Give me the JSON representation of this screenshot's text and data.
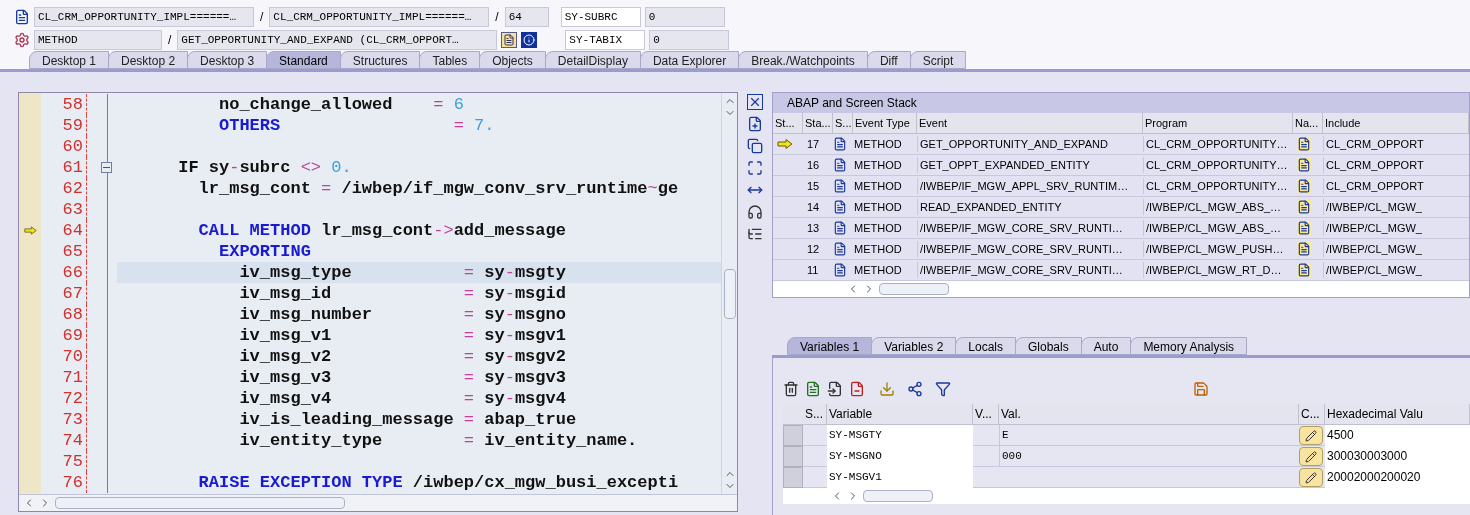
{
  "header": {
    "rows": [
      {
        "fields": [
          {
            "kind": "field",
            "text": "CL_CRM_OPPORTUNITY_IMPL======…"
          },
          {
            "kind": "sep",
            "text": "/"
          },
          {
            "kind": "field",
            "text": "CL_CRM_OPPORTUNITY_IMPL======…"
          },
          {
            "kind": "sep",
            "text": "/"
          },
          {
            "kind": "field",
            "text": "64"
          },
          {
            "kind": "sysname",
            "text": "SY-SUBRC"
          },
          {
            "kind": "field",
            "text": "0"
          }
        ]
      },
      {
        "fields": [
          {
            "kind": "field",
            "text": "METHOD"
          },
          {
            "kind": "sep",
            "text": "/"
          },
          {
            "kind": "field",
            "text": "GET_OPPORTUNITY_AND_EXPAND (CL_CRM_OPPORT…"
          },
          {
            "kind": "buttons"
          },
          {
            "kind": "sysname",
            "text": "SY-TABIX"
          },
          {
            "kind": "field",
            "text": "0"
          }
        ]
      }
    ]
  },
  "tabs": [
    {
      "label": "Desktop 1",
      "selected": false
    },
    {
      "label": "Desktop 2",
      "selected": false
    },
    {
      "label": "Desktop 3",
      "selected": false
    },
    {
      "label": "Standard",
      "selected": true
    },
    {
      "label": "Structures",
      "selected": false
    },
    {
      "label": "Tables",
      "selected": false
    },
    {
      "label": "Objects",
      "selected": false
    },
    {
      "label": "DetailDisplay",
      "selected": false
    },
    {
      "label": "Data Explorer",
      "selected": false
    },
    {
      "label": "Break./Watchpoints",
      "selected": false
    },
    {
      "label": "Diff",
      "selected": false
    },
    {
      "label": "Script",
      "selected": false
    }
  ],
  "editor": {
    "lines": [
      {
        "number": "58",
        "current": false,
        "cursor": false,
        "fold": false,
        "segments": [
          {
            "kind": "plain",
            "text": "          no_change_allowed    "
          },
          {
            "kind": "operator",
            "text": "="
          },
          {
            "kind": "number",
            "text": " 6"
          }
        ]
      },
      {
        "number": "59",
        "current": false,
        "cursor": false,
        "fold": false,
        "segments": [
          {
            "kind": "keyword",
            "text": "          OTHERS                 "
          },
          {
            "kind": "operator",
            "text": "="
          },
          {
            "kind": "number",
            "text": " 7."
          }
        ]
      },
      {
        "number": "60",
        "current": false,
        "cursor": false,
        "fold": false
      },
      {
        "number": "61",
        "current": false,
        "cursor": false,
        "fold": true,
        "segments": [
          {
            "kind": "plain",
            "text": "      IF sy"
          },
          {
            "kind": "operator",
            "text": "-"
          },
          {
            "kind": "plain",
            "text": "subrc "
          },
          {
            "kind": "operator",
            "text": "<>"
          },
          {
            "kind": "number",
            "text": " 0."
          }
        ]
      },
      {
        "number": "62",
        "current": false,
        "cursor": false,
        "fold": false,
        "segments": [
          {
            "kind": "plain",
            "text": "        lr_msg_cont "
          },
          {
            "kind": "operator",
            "text": "="
          },
          {
            "kind": "plain",
            "text": " /iwbep/if_mgw_conv_srv_runtime"
          },
          {
            "kind": "operator",
            "text": "~"
          },
          {
            "kind": "plain",
            "text": "ge"
          }
        ]
      },
      {
        "number": "63",
        "current": false,
        "cursor": false,
        "fold": false
      },
      {
        "number": "64",
        "current": true,
        "cursor": false,
        "fold": false,
        "segments": [
          {
            "kind": "keyword",
            "text": "        CALL METHOD"
          },
          {
            "kind": "plain",
            "text": " lr_msg_cont"
          },
          {
            "kind": "operator",
            "text": "->"
          },
          {
            "kind": "plain",
            "text": "add_message"
          }
        ]
      },
      {
        "number": "65",
        "current": false,
        "cursor": false,
        "fold": false,
        "segments": [
          {
            "kind": "keyword",
            "text": "          EXPORTING"
          }
        ]
      },
      {
        "number": "66",
        "current": false,
        "cursor": true,
        "fold": false,
        "segments": [
          {
            "kind": "plain",
            "text": "            iv_msg_type           "
          },
          {
            "kind": "operator",
            "text": "="
          },
          {
            "kind": "plain",
            "text": " sy"
          },
          {
            "kind": "operator",
            "text": "-"
          },
          {
            "kind": "plain",
            "text": "msgty"
          }
        ]
      },
      {
        "number": "67",
        "current": false,
        "cursor": false,
        "fold": false,
        "segments": [
          {
            "kind": "plain",
            "text": "            iv_msg_id             "
          },
          {
            "kind": "operator",
            "text": "="
          },
          {
            "kind": "plain",
            "text": " sy"
          },
          {
            "kind": "operator",
            "text": "-"
          },
          {
            "kind": "plain",
            "text": "msgid"
          }
        ]
      },
      {
        "number": "68",
        "current": false,
        "cursor": false,
        "fold": false,
        "segments": [
          {
            "kind": "plain",
            "text": "            iv_msg_number         "
          },
          {
            "kind": "operator",
            "text": "="
          },
          {
            "kind": "plain",
            "text": " sy"
          },
          {
            "kind": "operator",
            "text": "-"
          },
          {
            "kind": "plain",
            "text": "msgno"
          }
        ]
      },
      {
        "number": "69",
        "current": false,
        "cursor": false,
        "fold": false,
        "segments": [
          {
            "kind": "plain",
            "text": "            iv_msg_v1             "
          },
          {
            "kind": "operator",
            "text": "="
          },
          {
            "kind": "plain",
            "text": " sy"
          },
          {
            "kind": "operator",
            "text": "-"
          },
          {
            "kind": "plain",
            "text": "msgv1"
          }
        ]
      },
      {
        "number": "70",
        "current": false,
        "cursor": false,
        "fold": false,
        "segments": [
          {
            "kind": "plain",
            "text": "            iv_msg_v2             "
          },
          {
            "kind": "operator",
            "text": "="
          },
          {
            "kind": "plain",
            "text": " sy"
          },
          {
            "kind": "operator",
            "text": "-"
          },
          {
            "kind": "plain",
            "text": "msgv2"
          }
        ]
      },
      {
        "number": "71",
        "current": false,
        "cursor": false,
        "fold": false,
        "segments": [
          {
            "kind": "plain",
            "text": "            iv_msg_v3             "
          },
          {
            "kind": "operator",
            "text": "="
          },
          {
            "kind": "plain",
            "text": " sy"
          },
          {
            "kind": "operator",
            "text": "-"
          },
          {
            "kind": "plain",
            "text": "msgv3"
          }
        ]
      },
      {
        "number": "72",
        "current": false,
        "cursor": false,
        "fold": false,
        "segments": [
          {
            "kind": "plain",
            "text": "            iv_msg_v4             "
          },
          {
            "kind": "operator",
            "text": "="
          },
          {
            "kind": "plain",
            "text": " sy"
          },
          {
            "kind": "operator",
            "text": "-"
          },
          {
            "kind": "plain",
            "text": "msgv4"
          }
        ]
      },
      {
        "number": "73",
        "current": false,
        "cursor": false,
        "fold": false,
        "segments": [
          {
            "kind": "plain",
            "text": "            iv_is_leading_message "
          },
          {
            "kind": "operator",
            "text": "="
          },
          {
            "kind": "plain",
            "text": " abap_true"
          }
        ]
      },
      {
        "number": "74",
        "current": false,
        "cursor": false,
        "fold": false,
        "segments": [
          {
            "kind": "plain",
            "text": "            iv_entity_type        "
          },
          {
            "kind": "operator",
            "text": "="
          },
          {
            "kind": "plain",
            "text": " iv_entity_name."
          }
        ]
      },
      {
        "number": "75",
        "current": false,
        "cursor": false,
        "fold": false
      },
      {
        "number": "76",
        "current": false,
        "cursor": false,
        "fold": false,
        "segments": [
          {
            "kind": "keyword",
            "text": "        RAISE EXCEPTION TYPE"
          },
          {
            "kind": "plain",
            "text": " /iwbep/cx_mgw_busi_excepti"
          }
        ]
      }
    ]
  },
  "stack": {
    "title": "ABAP and Screen Stack",
    "columns": [
      "St...",
      "Sta...",
      "S...",
      "Event Type",
      "Event",
      "Program",
      "Na...",
      "Include"
    ],
    "rows": [
      {
        "current": true,
        "stack_no": "17",
        "event_type": "METHOD",
        "event": "GET_OPPORTUNITY_AND_EXPAND",
        "program": "CL_CRM_OPPORTUNITY…",
        "include": "CL_CRM_OPPORT"
      },
      {
        "current": false,
        "stack_no": "16",
        "event_type": "METHOD",
        "event": "GET_OPPT_EXPANDED_ENTITY",
        "program": "CL_CRM_OPPORTUNITY…",
        "include": "CL_CRM_OPPORT"
      },
      {
        "current": false,
        "stack_no": "15",
        "event_type": "METHOD",
        "event": "/IWBEP/IF_MGW_APPL_SRV_RUNTIM…",
        "program": "CL_CRM_OPPORTUNITY…",
        "include": "CL_CRM_OPPORT"
      },
      {
        "current": false,
        "stack_no": "14",
        "event_type": "METHOD",
        "event": "READ_EXPANDED_ENTITY",
        "program": "/IWBEP/CL_MGW_ABS_…",
        "include": "/IWBEP/CL_MGW_"
      },
      {
        "current": false,
        "stack_no": "13",
        "event_type": "METHOD",
        "event": "/IWBEP/IF_MGW_CORE_SRV_RUNTI…",
        "program": "/IWBEP/CL_MGW_ABS_…",
        "include": "/IWBEP/CL_MGW_"
      },
      {
        "current": false,
        "stack_no": "12",
        "event_type": "METHOD",
        "event": "/IWBEP/IF_MGW_CORE_SRV_RUNTI…",
        "program": "/IWBEP/CL_MGW_PUSH…",
        "include": "/IWBEP/CL_MGW_"
      },
      {
        "current": false,
        "stack_no": "11",
        "event_type": "METHOD",
        "event": "/IWBEP/IF_MGW_CORE_SRV_RUNTI…",
        "program": "/IWBEP/CL_MGW_RT_D…",
        "include": "/IWBEP/CL_MGW_"
      }
    ]
  },
  "variables": {
    "tabs": [
      {
        "label": "Variables 1",
        "selected": true
      },
      {
        "label": "Variables 2",
        "selected": false
      },
      {
        "label": "Locals",
        "selected": false
      },
      {
        "label": "Globals",
        "selected": false
      },
      {
        "label": "Auto",
        "selected": false
      },
      {
        "label": "Memory Analysis",
        "selected": false
      }
    ],
    "columns": [
      "S...",
      "Variable",
      "V...",
      "Val.",
      "C...",
      "Hexadecimal Valu"
    ],
    "rows": [
      {
        "variable": "SY-MSGTY",
        "value": "E",
        "hex": "4500"
      },
      {
        "variable": "SY-MSGNO",
        "value": "000",
        "hex": "300030003000"
      },
      {
        "variable": "SY-MSGV1",
        "hex": "20002000200020"
      }
    ]
  }
}
